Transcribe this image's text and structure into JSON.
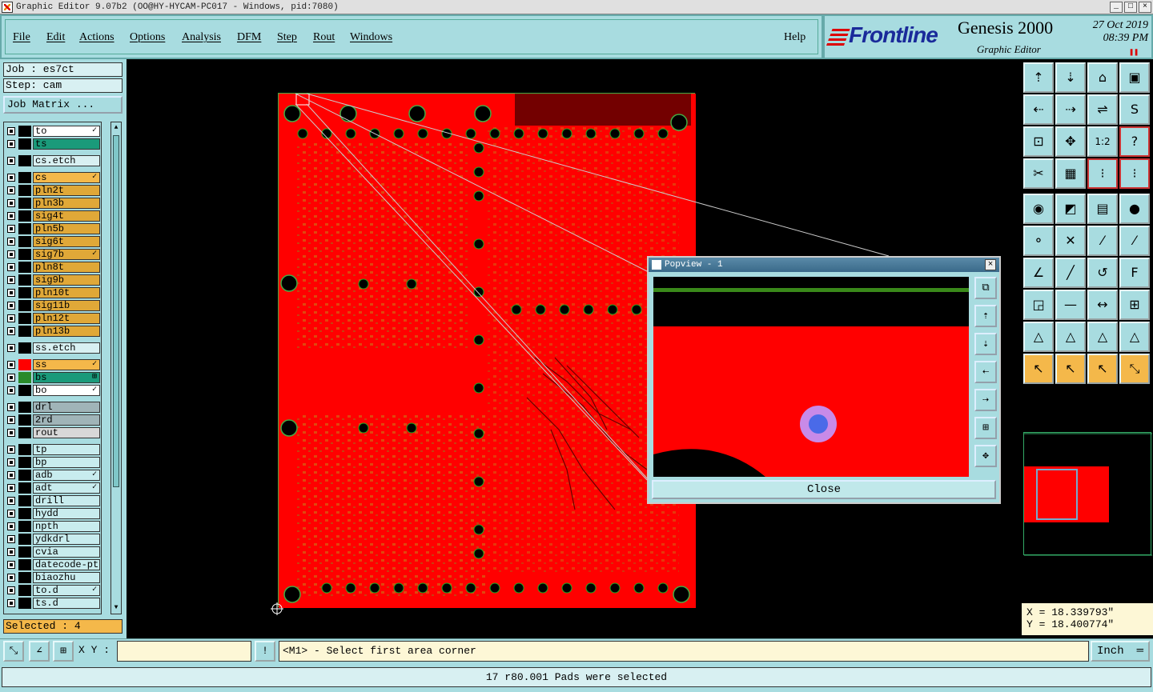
{
  "window": {
    "title": "Graphic Editor 9.07b2 (OO@HY-HYCAM-PC017 - Windows, pid:7080)",
    "controls": [
      "_",
      "□",
      "×"
    ]
  },
  "menu": {
    "items": [
      "File",
      "Edit",
      "Actions",
      "Options",
      "Analysis",
      "DFM",
      "Step",
      "Rout",
      "Windows"
    ],
    "help": "Help"
  },
  "brand": {
    "logo": "Frontline",
    "product": "Genesis 2000",
    "subtitle": "Graphic Editor",
    "date": "27 Oct 2019",
    "time": "08:39 PM",
    "accent": "#1a2a9a"
  },
  "left_panel": {
    "job": "Job : es7ct",
    "step": "Step: cam",
    "job_matrix": "Job Matrix ...",
    "selected": "Selected : 4",
    "layers": [
      {
        "name": "to",
        "color": "#ffffff",
        "swatch": "#000000",
        "mark": "✓"
      },
      {
        "name": "ts",
        "color": "#1a9a7a",
        "swatch": "#000000",
        "mark": ""
      },
      {
        "name": "cs.etch",
        "color": "#d8f0f2",
        "swatch": "#000000",
        "mark": ""
      },
      {
        "name": "cs",
        "color": "#f4b84a",
        "swatch": "#000000",
        "mark": "✓"
      },
      {
        "name": "pln2t",
        "color": "#e0a838",
        "swatch": "#000000",
        "mark": ""
      },
      {
        "name": "pln3b",
        "color": "#e0a838",
        "swatch": "#000000",
        "mark": ""
      },
      {
        "name": "sig4t",
        "color": "#e0a838",
        "swatch": "#000000",
        "mark": ""
      },
      {
        "name": "pln5b",
        "color": "#e0a838",
        "swatch": "#000000",
        "mark": ""
      },
      {
        "name": "sig6t",
        "color": "#e0a838",
        "swatch": "#000000",
        "mark": ""
      },
      {
        "name": "sig7b",
        "color": "#e0a838",
        "swatch": "#000000",
        "mark": "✓"
      },
      {
        "name": "pln8t",
        "color": "#e0a838",
        "swatch": "#000000",
        "mark": ""
      },
      {
        "name": "sig9b",
        "color": "#e0a838",
        "swatch": "#000000",
        "mark": ""
      },
      {
        "name": "pln10t",
        "color": "#e0a838",
        "swatch": "#000000",
        "mark": ""
      },
      {
        "name": "sig11b",
        "color": "#e0a838",
        "swatch": "#000000",
        "mark": ""
      },
      {
        "name": "pln12t",
        "color": "#e0a838",
        "swatch": "#000000",
        "mark": ""
      },
      {
        "name": "pln13b",
        "color": "#e0a838",
        "swatch": "#000000",
        "mark": ""
      },
      {
        "name": "ss.etch",
        "color": "#d8f0f2",
        "swatch": "#000000",
        "mark": ""
      },
      {
        "name": "ss",
        "color": "#f4b84a",
        "swatch": "#ff0000",
        "mark": "✓"
      },
      {
        "name": "bs",
        "color": "#1a9a7a",
        "swatch": "#2a8a2a",
        "mark": "⊞"
      },
      {
        "name": "bo",
        "color": "#ffffff",
        "swatch": "#000000",
        "mark": "✓"
      },
      {
        "name": "drl",
        "color": "#a0b4b8",
        "swatch": "#000000",
        "mark": ""
      },
      {
        "name": "2rd",
        "color": "#a0b4b8",
        "swatch": "#000000",
        "mark": ""
      },
      {
        "name": "rout",
        "color": "#d8d8d8",
        "swatch": "#000000",
        "mark": ""
      },
      {
        "name": "tp",
        "color": "#c8ecee",
        "swatch": "#000000",
        "mark": ""
      },
      {
        "name": "bp",
        "color": "#c8ecee",
        "swatch": "#000000",
        "mark": ""
      },
      {
        "name": "adb",
        "color": "#c8ecee",
        "swatch": "#000000",
        "mark": "✓"
      },
      {
        "name": "adt",
        "color": "#c8ecee",
        "swatch": "#000000",
        "mark": "✓"
      },
      {
        "name": "drill",
        "color": "#c8ecee",
        "swatch": "#000000",
        "mark": ""
      },
      {
        "name": "hydd",
        "color": "#c8ecee",
        "swatch": "#000000",
        "mark": ""
      },
      {
        "name": "npth",
        "color": "#c8ecee",
        "swatch": "#000000",
        "mark": ""
      },
      {
        "name": "ydkdrl",
        "color": "#c8ecee",
        "swatch": "#000000",
        "mark": ""
      },
      {
        "name": "cvia",
        "color": "#c8ecee",
        "swatch": "#000000",
        "mark": ""
      },
      {
        "name": "datecode-pt",
        "color": "#c8ecee",
        "swatch": "#000000",
        "mark": ""
      },
      {
        "name": "biaozhu",
        "color": "#c8ecee",
        "swatch": "#000000",
        "mark": ""
      },
      {
        "name": "to.d",
        "color": "#c8ecee",
        "swatch": "#000000",
        "mark": "✓"
      },
      {
        "name": "ts.d",
        "color": "#c8ecee",
        "swatch": "#000000",
        "mark": ""
      }
    ]
  },
  "popview": {
    "title": "Popview - 1",
    "close_label": "Close",
    "tools": [
      "zoom-home-icon",
      "pan-up-icon",
      "pan-down-icon",
      "pan-left-icon",
      "pan-right-icon",
      "zoom-in-icon",
      "zoom-out-icon"
    ]
  },
  "right_panel": {
    "coord_x": "X = 18.339793\"",
    "coord_y": "Y = 18.400774\"",
    "tool_icons": [
      "zoom-up-icon",
      "zoom-down-icon",
      "home-icon",
      "window-icon",
      "pan-left-icon",
      "pan-right-icon",
      "ratio-icon",
      "scissors-icon",
      "fit-icon",
      "center-icon",
      "one-to-one-icon",
      "help-icon",
      "measure-icon",
      "grid-icon",
      "net-red-icon",
      "net-red2-icon",
      "snap-icon",
      "color-icon",
      "ruler-icon",
      "pad-icon",
      "net-icon",
      "cross-icon",
      "line-red-icon",
      "line-red2-icon",
      "angle-icon",
      "diag-icon",
      "arc-icon",
      "flip-icon",
      "move-icon",
      "stretch-icon",
      "box-icon",
      "group-icon",
      "tri-icon",
      "tri2-icon",
      "tri3-icon",
      "tri4-icon",
      "pointer-icon",
      "pointer2-icon",
      "pointer3-icon",
      "select-icon"
    ],
    "tool_glyphs": [
      "⇡",
      "⇣",
      "⌂",
      "▣",
      "⇠",
      "⇢",
      "⇌",
      "S",
      "⊡",
      "✥",
      "1:2",
      "?",
      "✂",
      "▦",
      "⁝",
      "⁝",
      "◉",
      "◩",
      "▤",
      "●",
      "⚬",
      "✕",
      "⁄",
      "⁄",
      "∠",
      "╱",
      "↺",
      "F",
      "◲",
      "—",
      "↔",
      "⊞",
      "△",
      "△",
      "△",
      "△",
      "↖",
      "↖",
      "↖",
      "⤡"
    ]
  },
  "bottom_bar": {
    "xy_label": "X Y :",
    "xy_value": "",
    "prompt": "<M1> - Select first area corner",
    "units": "Inch",
    "status": "17 r80.001 Pads were selected"
  }
}
